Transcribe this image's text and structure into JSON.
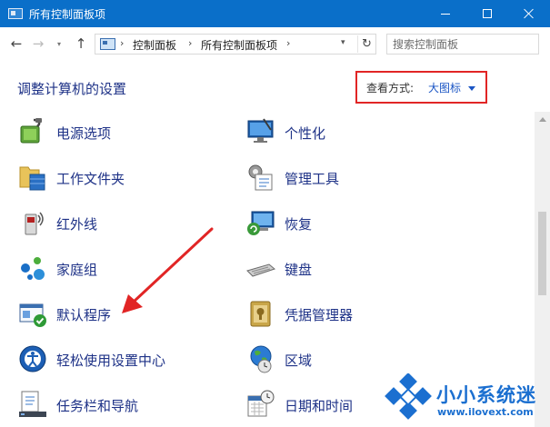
{
  "window": {
    "title": "所有控制面板项",
    "minimize_icon": "minimize-icon",
    "maximize_icon": "maximize-icon",
    "close_icon": "close-icon",
    "accent_color": "#0a6fc9"
  },
  "nav": {
    "back_glyph": "←",
    "forward_glyph": "→",
    "recent_glyph": "▾",
    "up_glyph": "↑"
  },
  "address": {
    "crumbs": [
      "控制面板",
      "所有控制面板项"
    ],
    "separator": "›",
    "dropdown_glyph": "▾",
    "refresh_glyph": "↻"
  },
  "search": {
    "placeholder": "搜索控制面板",
    "value": ""
  },
  "header": {
    "title": "调整计算机的设置",
    "view_label": "查看方式:",
    "view_value": "大图标",
    "highlight_color": "#e12525"
  },
  "items": {
    "left": [
      {
        "label": "电源选项",
        "icon": "power-options-icon"
      },
      {
        "label": "工作文件夹",
        "icon": "work-folders-icon"
      },
      {
        "label": "红外线",
        "icon": "infrared-icon"
      },
      {
        "label": "家庭组",
        "icon": "homegroup-icon"
      },
      {
        "label": "默认程序",
        "icon": "default-programs-icon"
      },
      {
        "label": "轻松使用设置中心",
        "icon": "ease-of-access-icon"
      },
      {
        "label": "任务栏和导航",
        "icon": "taskbar-navigation-icon"
      }
    ],
    "right": [
      {
        "label": "个性化",
        "icon": "personalization-icon"
      },
      {
        "label": "管理工具",
        "icon": "administrative-tools-icon"
      },
      {
        "label": "恢复",
        "icon": "recovery-icon"
      },
      {
        "label": "键盘",
        "icon": "keyboard-icon"
      },
      {
        "label": "凭据管理器",
        "icon": "credential-manager-icon"
      },
      {
        "label": "区域",
        "icon": "region-icon"
      },
      {
        "label": "日期和时间",
        "icon": "date-time-icon"
      }
    ]
  },
  "watermark": {
    "title": "小小系统迷",
    "url": "www.ilovext.com"
  }
}
